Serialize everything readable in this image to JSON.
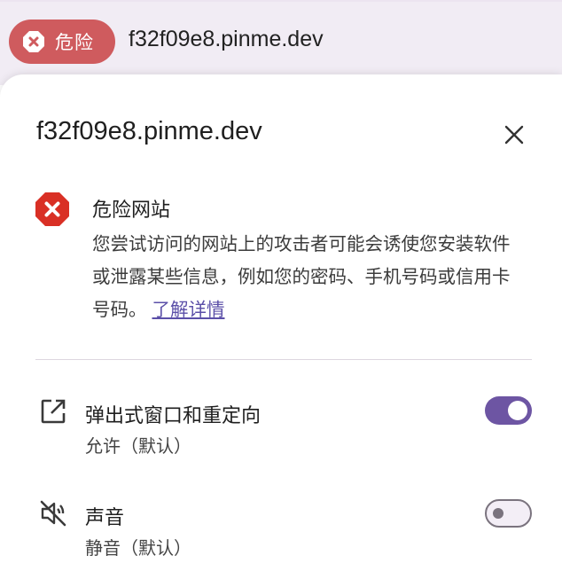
{
  "address_bar": {
    "chip_label": "危险",
    "url": "f32f09e8.pinme.dev"
  },
  "popup": {
    "site_title": "f32f09e8.pinme.dev",
    "warning": {
      "heading": "危险网站",
      "description": "您尝试访问的网站上的攻击者可能会诱使您安装软件或泄露某些信息，例如您的密码、手机号码或信用卡号码。",
      "learn_more": "了解详情"
    },
    "permissions": [
      {
        "title": "弹出式窗口和重定向",
        "value": "允许（默认）",
        "enabled": true
      },
      {
        "title": "声音",
        "value": "静音（默认）",
        "enabled": false
      }
    ]
  },
  "colors": {
    "danger": "#cf5b5e",
    "danger_icon": "#d93025",
    "accent": "#6d55a3",
    "link": "#5b4fa8"
  },
  "icons": {
    "chip": "danger-octagon-icon",
    "close": "close-icon",
    "warning": "danger-octagon-icon",
    "popups": "open-in-new-icon",
    "sound": "volume-off-icon"
  }
}
